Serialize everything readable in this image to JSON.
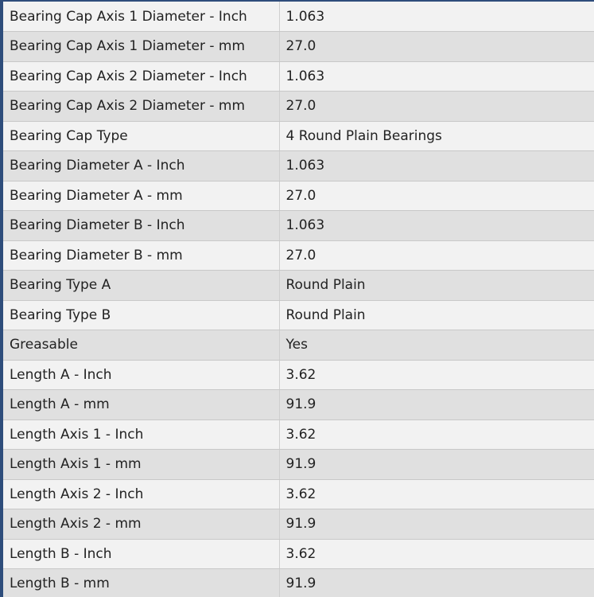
{
  "specs": {
    "rows": [
      {
        "name": "Bearing Cap Axis 1 Diameter - Inch",
        "value": "1.063"
      },
      {
        "name": "Bearing Cap Axis 1 Diameter - mm",
        "value": "27.0"
      },
      {
        "name": "Bearing Cap Axis 2 Diameter - Inch",
        "value": "1.063"
      },
      {
        "name": "Bearing Cap Axis 2 Diameter - mm",
        "value": "27.0"
      },
      {
        "name": "Bearing Cap Type",
        "value": "4 Round Plain Bearings"
      },
      {
        "name": "Bearing Diameter A - Inch",
        "value": "1.063"
      },
      {
        "name": "Bearing Diameter A - mm",
        "value": "27.0"
      },
      {
        "name": "Bearing Diameter B - Inch",
        "value": "1.063"
      },
      {
        "name": "Bearing Diameter B - mm",
        "value": "27.0"
      },
      {
        "name": "Bearing Type A",
        "value": "Round Plain"
      },
      {
        "name": "Bearing Type B",
        "value": "Round Plain"
      },
      {
        "name": "Greasable",
        "value": "Yes"
      },
      {
        "name": "Length A - Inch",
        "value": "3.62"
      },
      {
        "name": "Length A - mm",
        "value": "91.9"
      },
      {
        "name": "Length Axis 1 - Inch",
        "value": "3.62"
      },
      {
        "name": "Length Axis 1 - mm",
        "value": "91.9"
      },
      {
        "name": "Length Axis 2 - Inch",
        "value": "3.62"
      },
      {
        "name": "Length Axis 2 - mm",
        "value": "91.9"
      },
      {
        "name": "Length B - Inch",
        "value": "3.62"
      },
      {
        "name": "Length B - mm",
        "value": "91.9"
      }
    ]
  },
  "colors": {
    "frame_accent": "#2e4d7b",
    "row_light": "#f2f2f2",
    "row_dark": "#e0e0e0",
    "text": "#222222"
  }
}
